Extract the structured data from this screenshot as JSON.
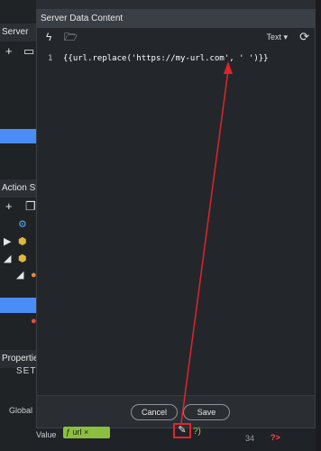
{
  "background": {
    "server_header": "Server",
    "action_steps_header": "Action Ste",
    "properties_header": "Propertie",
    "properties_section": "SET",
    "global_label": "Global",
    "value_label": "Value",
    "value_token": "ƒ url ×",
    "line_number_bottom": "34",
    "error_marker": "?>"
  },
  "dialog": {
    "title": "Server Data Content",
    "mode": "Text",
    "code_line_number": "1",
    "code": "{{url.replace('https://my-url.com', ' ')}}",
    "cancel_label": "Cancel",
    "save_label": "Save"
  },
  "colors": {
    "accent": "#4a8df6",
    "value_token": "#8cbf3f",
    "highlight": "#e0242a"
  }
}
